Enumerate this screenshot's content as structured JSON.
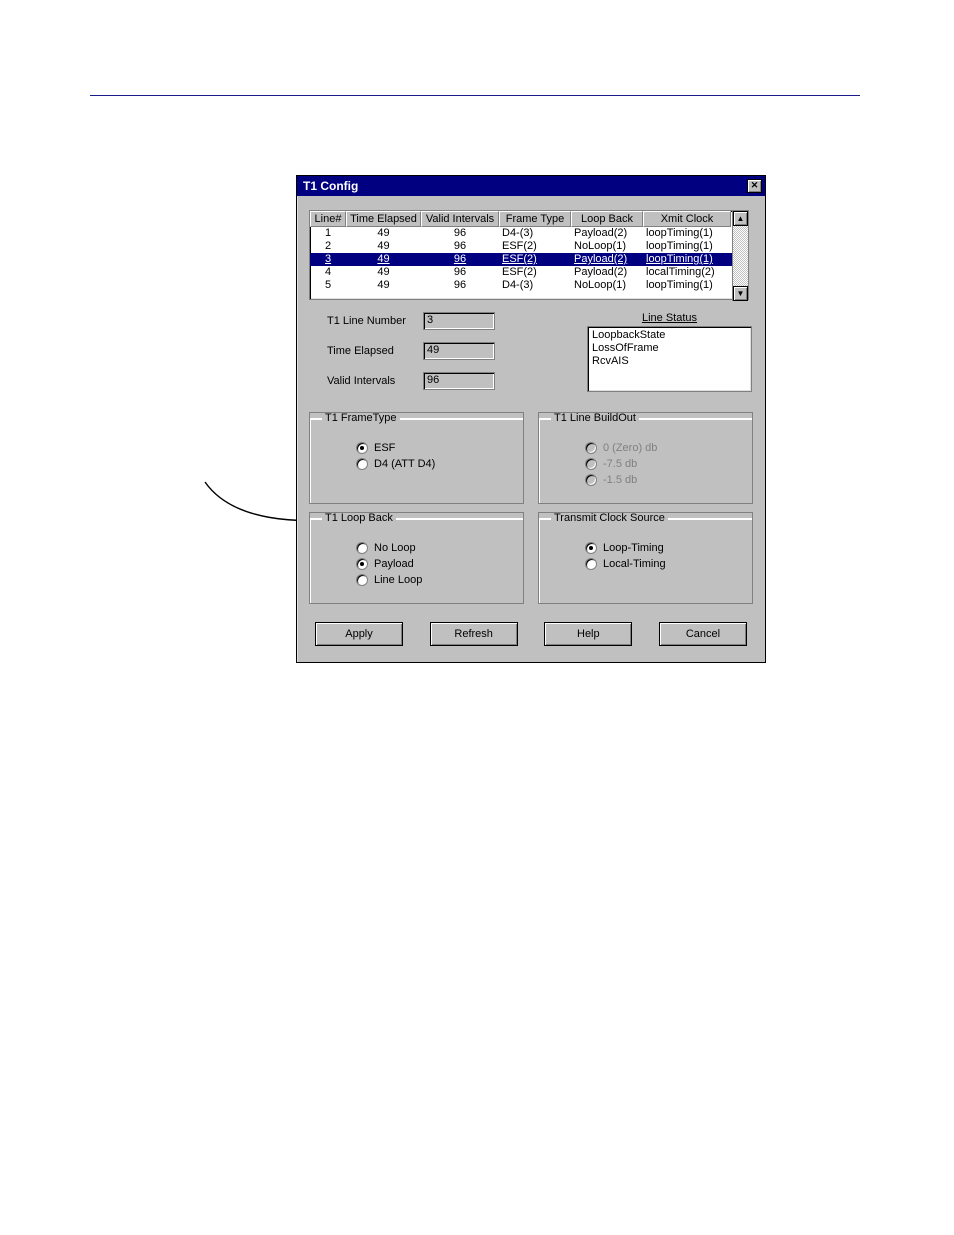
{
  "dialog": {
    "title": "T1 Config"
  },
  "table": {
    "headers": {
      "line": "Line#",
      "time_elapsed": "Time Elapsed",
      "valid_intervals": "Valid Intervals",
      "frame_type": "Frame Type",
      "loop_back": "Loop Back",
      "xmit_clock": "Xmit Clock"
    },
    "rows": [
      {
        "line": "1",
        "te": "49",
        "vi": "96",
        "ft": "D4-(3)",
        "lb": "Payload(2)",
        "xc": "loopTiming(1)",
        "selected": false
      },
      {
        "line": "2",
        "te": "49",
        "vi": "96",
        "ft": "ESF(2)",
        "lb": "NoLoop(1)",
        "xc": "loopTiming(1)",
        "selected": false
      },
      {
        "line": "3",
        "te": "49",
        "vi": "96",
        "ft": "ESF(2)",
        "lb": "Payload(2)",
        "xc": "loopTiming(1)",
        "selected": true
      },
      {
        "line": "4",
        "te": "49",
        "vi": "96",
        "ft": "ESF(2)",
        "lb": "Payload(2)",
        "xc": "localTiming(2)",
        "selected": false
      },
      {
        "line": "5",
        "te": "49",
        "vi": "96",
        "ft": "D4-(3)",
        "lb": "NoLoop(1)",
        "xc": "loopTiming(1)",
        "selected": false
      }
    ]
  },
  "fields": {
    "line_number": {
      "label": "T1 Line Number",
      "value": "3"
    },
    "time_elapsed": {
      "label": "Time Elapsed",
      "value": "49"
    },
    "valid_intervals": {
      "label": "Valid Intervals",
      "value": "96"
    }
  },
  "line_status": {
    "legend": "Line Status",
    "items": [
      "LoopbackState",
      "LossOfFrame",
      "RcvAIS"
    ]
  },
  "groups": {
    "frame_type": {
      "legend": "T1 FrameType",
      "options": [
        {
          "label": "ESF",
          "checked": true
        },
        {
          "label": "D4 (ATT D4)",
          "checked": false
        }
      ]
    },
    "build_out": {
      "legend": "T1 Line BuildOut",
      "options": [
        {
          "label": "0 (Zero) db",
          "checked": false,
          "disabled": true
        },
        {
          "label": "-7.5 db",
          "checked": false,
          "disabled": true
        },
        {
          "label": "-1.5 db",
          "checked": false,
          "disabled": true
        }
      ]
    },
    "loop_back": {
      "legend": "T1 Loop Back",
      "options": [
        {
          "label": "No Loop",
          "checked": false
        },
        {
          "label": "Payload",
          "checked": true
        },
        {
          "label": "Line Loop",
          "checked": false
        }
      ]
    },
    "xmit_clock": {
      "legend": "Transmit Clock Source",
      "options": [
        {
          "label": "Loop-Timing",
          "checked": true
        },
        {
          "label": "Local-Timing",
          "checked": false
        }
      ]
    }
  },
  "buttons": {
    "apply": "Apply",
    "refresh": "Refresh",
    "help": "Help",
    "cancel": "Cancel"
  }
}
